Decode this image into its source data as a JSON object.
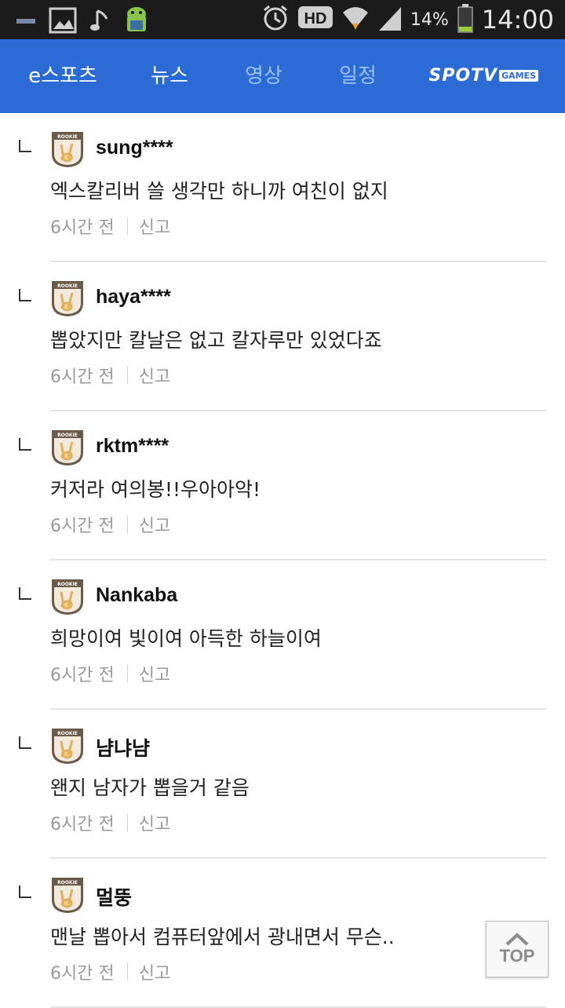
{
  "status_bar": {
    "battery_percent": "14%",
    "time": "14:00",
    "icons": [
      "minus-icon",
      "image-icon",
      "music-note-icon",
      "android-icon",
      "alarm-icon",
      "hd-icon",
      "wifi-icon",
      "signal-icon",
      "battery-icon"
    ]
  },
  "nav": {
    "tabs": [
      {
        "label": "e스포츠",
        "active": true
      },
      {
        "label": "뉴스",
        "active": true
      },
      {
        "label": "영상",
        "active": false
      },
      {
        "label": "일정",
        "active": false
      }
    ],
    "brand_main": "SPOTV",
    "brand_sub": "GAMES",
    "accent": "#2b6bd6"
  },
  "badge_label": "ROOKIE",
  "comments": [
    {
      "user": "sung****",
      "text": "엑스칼리버 쓸 생각만 하니까 여친이 없지",
      "time": "6시간 전",
      "report": "신고"
    },
    {
      "user": "haya****",
      "text": "뽑았지만 칼날은 없고 칼자루만 있었다죠",
      "time": "6시간 전",
      "report": "신고"
    },
    {
      "user": "rktm****",
      "text": "커저라 여의봉!!우아아악!",
      "time": "6시간 전",
      "report": "신고"
    },
    {
      "user": "Nankaba",
      "text": "희망이여 빛이여 아득한 하늘이여",
      "time": "6시간 전",
      "report": "신고"
    },
    {
      "user": "냠냐냠",
      "text": "왠지 남자가 뽑을거 같음",
      "time": "6시간 전",
      "report": "신고"
    },
    {
      "user": "멀뚱",
      "text": "맨날 뽑아서 컴퓨터앞에서 광내면서 무슨..",
      "time": "6시간 전",
      "report": "신고"
    }
  ],
  "top_button": {
    "label": "TOP"
  }
}
